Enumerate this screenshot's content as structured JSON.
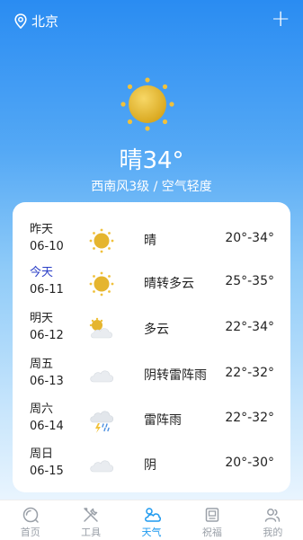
{
  "header": {
    "city": "北京",
    "add_label": "+"
  },
  "hero": {
    "title": "晴34°",
    "subtitle": "西南风3级 / 空气轻度",
    "icon": "sun"
  },
  "forecast": [
    {
      "day": "昨天",
      "date": "06-10",
      "icon": "sun",
      "desc": "晴",
      "temp": "20°-34°",
      "today": false
    },
    {
      "day": "今天",
      "date": "06-11",
      "icon": "sun",
      "desc": "晴转多云",
      "temp": "25°-35°",
      "today": true
    },
    {
      "day": "明天",
      "date": "06-12",
      "icon": "partly-cloudy",
      "desc": "多云",
      "temp": "22°-34°",
      "today": false
    },
    {
      "day": "周五",
      "date": "06-13",
      "icon": "cloud",
      "desc": "阴转雷阵雨",
      "temp": "22°-32°",
      "today": false
    },
    {
      "day": "周六",
      "date": "06-14",
      "icon": "thunderstorm",
      "desc": "雷阵雨",
      "temp": "22°-32°",
      "today": false
    },
    {
      "day": "周日",
      "date": "06-15",
      "icon": "cloud",
      "desc": "阴",
      "temp": "20°-30°",
      "today": false
    }
  ],
  "tabs": [
    {
      "label": "首页",
      "icon": "home-icon",
      "active": false
    },
    {
      "label": "工具",
      "icon": "tools-icon",
      "active": false
    },
    {
      "label": "天气",
      "icon": "weather-icon",
      "active": true
    },
    {
      "label": "祝福",
      "icon": "blessing-icon",
      "active": false
    },
    {
      "label": "我的",
      "icon": "profile-icon",
      "active": false
    }
  ],
  "colors": {
    "accent": "#1f9aef",
    "today": "#2b3fc7",
    "sun": "#f2c23a"
  }
}
